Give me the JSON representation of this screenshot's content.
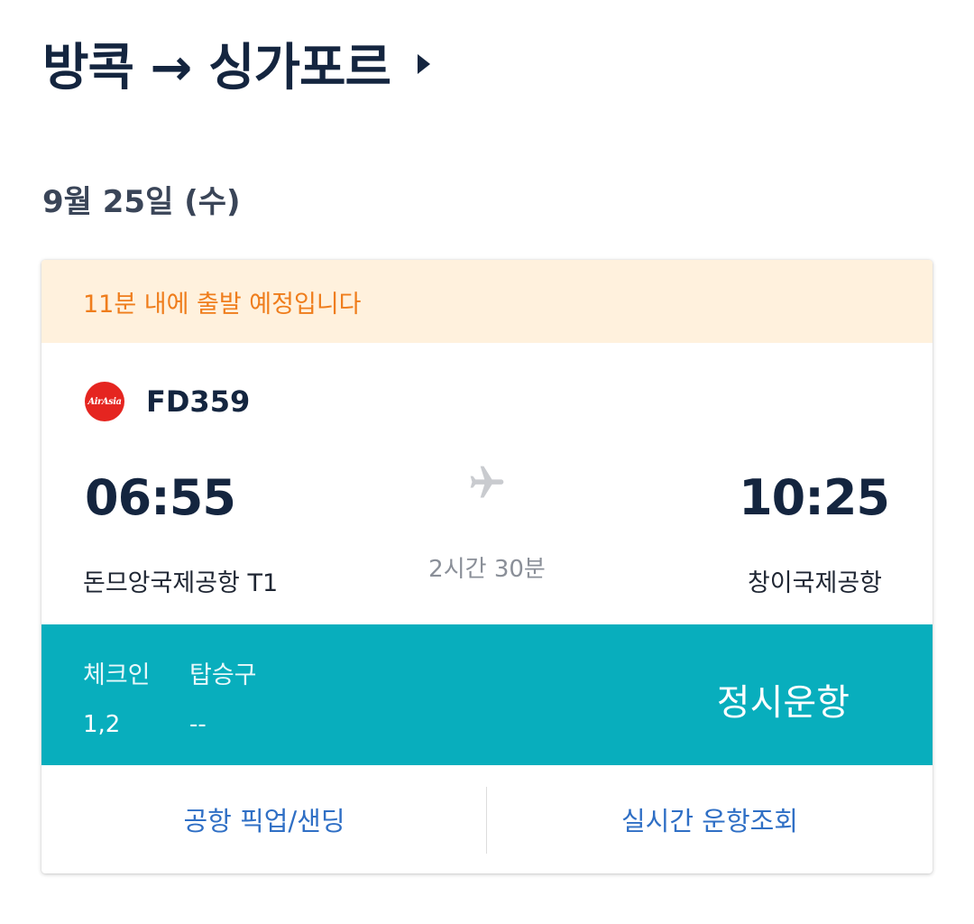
{
  "header": {
    "route": "방콕 → 싱가포르",
    "date": "9월 25일 (수)"
  },
  "card": {
    "notice": "11분 내에 출발 예정입니다",
    "airline_logo_text": "AirAsia",
    "flight_number": "FD359",
    "departure": {
      "time": "06:55",
      "airport": "돈므앙국제공항 T1"
    },
    "arrival": {
      "time": "10:25",
      "airport": "창이국제공항"
    },
    "duration": "2시간 30분",
    "status_bar": {
      "checkin_label": "체크인",
      "gate_label": "탑승구",
      "checkin_value": "1,2",
      "gate_value": "--",
      "status": "정시운항"
    },
    "actions": {
      "pickup_label": "공항 픽업/샌딩",
      "live_status_label": "실시간 운항조회"
    }
  },
  "colors": {
    "notice_bg": "#fff1dd",
    "notice_text": "#ef7d1c",
    "status_bar_bg": "#08aebd",
    "action_text": "#2f6fc5",
    "title_text": "#14253f",
    "airline_red": "#e52520"
  },
  "icons": {
    "route_chevron": "chevron-right-icon",
    "plane": "airplane-icon",
    "airline": "airasia-logo"
  }
}
